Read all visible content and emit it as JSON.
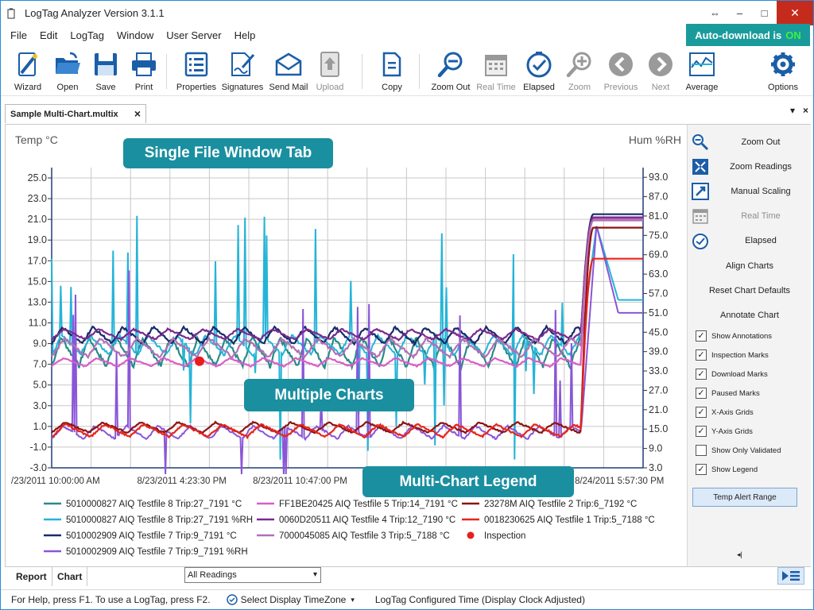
{
  "window": {
    "title": "LogTag Analyzer  Version 3.1.1"
  },
  "menu": [
    "File",
    "Edit",
    "LogTag",
    "Window",
    "User Server",
    "Help"
  ],
  "auto_download": {
    "label": "Auto-download is",
    "state": "ON"
  },
  "toolbar": [
    {
      "label": "Wizard",
      "icon": "wizard-icon",
      "enabled": true
    },
    {
      "label": "Open",
      "icon": "open-folder-icon",
      "enabled": true
    },
    {
      "label": "Save",
      "icon": "save-icon",
      "enabled": true
    },
    {
      "label": "Print",
      "icon": "printer-icon",
      "enabled": true
    },
    {
      "label": "Properties",
      "icon": "properties-icon",
      "enabled": true
    },
    {
      "label": "Signatures",
      "icon": "signatures-icon",
      "enabled": true
    },
    {
      "label": "Send Mail",
      "icon": "mail-icon",
      "enabled": true
    },
    {
      "label": "Upload",
      "icon": "upload-icon",
      "enabled": false
    },
    {
      "label": "Copy",
      "icon": "copy-icon",
      "enabled": true
    },
    {
      "label": "Zoom Out",
      "icon": "zoom-out-icon",
      "enabled": true
    },
    {
      "label": "Real Time",
      "icon": "calendar-icon",
      "enabled": false
    },
    {
      "label": "Elapsed",
      "icon": "clock-check-icon",
      "enabled": true
    },
    {
      "label": "Zoom",
      "icon": "zoom-in-icon",
      "enabled": false
    },
    {
      "label": "Previous",
      "icon": "previous-icon",
      "enabled": false
    },
    {
      "label": "Next",
      "icon": "next-icon",
      "enabled": false
    },
    {
      "label": "Average",
      "icon": "average-chart-icon",
      "enabled": true
    },
    {
      "label": "Options",
      "icon": "gear-icon",
      "enabled": true
    }
  ],
  "document_tab": {
    "label": "Sample Multi-Chart.multix",
    "close": "×"
  },
  "tab_controls": {
    "dropdown": "▾",
    "close": "×"
  },
  "callouts": {
    "tab": "Single File Window Tab",
    "charts": "Multiple Charts",
    "legend": "Multi-Chart Legend"
  },
  "right_panel": {
    "buttons": [
      {
        "label": "Zoom Out",
        "icon": "zoom-out-icon",
        "enabled": true
      },
      {
        "label": "Zoom Readings",
        "icon": "zoom-readings-icon",
        "enabled": true
      },
      {
        "label": "Manual Scaling",
        "icon": "manual-scaling-icon",
        "enabled": true
      },
      {
        "label": "Real Time",
        "icon": "calendar-icon",
        "enabled": false
      },
      {
        "label": "Elapsed",
        "icon": "clock-check-icon",
        "enabled": true
      }
    ],
    "plain": [
      "Align Charts",
      "Reset Chart Defaults",
      "Annotate Chart"
    ],
    "checks": [
      {
        "label": "Show Annotations",
        "checked": true
      },
      {
        "label": "Inspection Marks",
        "checked": true
      },
      {
        "label": "Download Marks",
        "checked": true
      },
      {
        "label": "Paused Marks",
        "checked": true
      },
      {
        "label": "X-Axis Grids",
        "checked": true
      },
      {
        "label": "Y-Axis Grids",
        "checked": true
      },
      {
        "label": "Show Only Validated",
        "checked": false
      },
      {
        "label": "Show Legend",
        "checked": true
      }
    ],
    "alert_button": "Temp Alert Range"
  },
  "bottom": {
    "tabs": [
      "Report",
      "Chart"
    ],
    "select": "All Readings",
    "select_arrow": "▾"
  },
  "status": {
    "help": "For Help, press F1. To use a LogTag, press F2.",
    "timezone": "Select Display TimeZone",
    "configured": "LogTag Configured Time (Display Clock Adjusted)"
  },
  "chart_data": {
    "type": "line",
    "ylabel_left": "Temp °C",
    "ylabel_right": "Hum %RH",
    "y_left_ticks": [
      "25.0",
      "23.0",
      "21.0",
      "19.0",
      "17.0",
      "15.0",
      "13.0",
      "11.0",
      "9.0",
      "7.0",
      "5.0",
      "3.0",
      "1.0",
      "-1.0",
      "-3.0"
    ],
    "y_right_ticks": [
      "93.0",
      "87.0",
      "81.0",
      "75.0",
      "69.0",
      "63.0",
      "57.0",
      "51.0",
      "45.0",
      "39.0",
      "33.0",
      "27.0",
      "21.0",
      "15.0",
      "9.0",
      "3.0"
    ],
    "ylim_left": [
      -3.0,
      26.0
    ],
    "ylim_right": [
      3.0,
      96.0
    ],
    "x_ticks": [
      "/23/2011 10:00:00 AM",
      "8/23/2011 4:23:30 PM",
      "8/23/2011 10:47:00 PM",
      "8/24/2011 5:57:30 PM"
    ],
    "grid": true,
    "inspection_mark": {
      "x_fraction": 0.25,
      "temp": 7.3
    },
    "series": [
      {
        "name": "5010000827 AIQ Testfile 8 Trip:27_7191 °C",
        "color": "#2a8a8a",
        "axis": "left",
        "base": 8.2,
        "amp": 1.4,
        "spike": 0,
        "end": 21.1,
        "end_mode": "rise"
      },
      {
        "name": "5010000827 AIQ Testfile 8 Trip:27_7191 %RH",
        "color": "#25b4d8",
        "axis": "right",
        "base": 41,
        "amp": 3,
        "spike": 7,
        "end": 55,
        "end_mode": "riseFall"
      },
      {
        "name": "5010002909 AIQ Testfile 7 Trip:9_7191 °C",
        "color": "#1b2a6b",
        "axis": "left",
        "base": 9.8,
        "amp": 0.8,
        "spike": 0,
        "end": 21.5,
        "end_mode": "rise"
      },
      {
        "name": "5010002909 AIQ Testfile 7 Trip:9_7191 %RH",
        "color": "#8a55d8",
        "axis": "right",
        "base": 14,
        "amp": 2,
        "spike": 9,
        "end": 51,
        "end_mode": "riseFall"
      },
      {
        "name": "FF1BE20425 AIQ Testfile 5 Trip:14_7191 °C",
        "color": "#d95ec8",
        "axis": "left",
        "base": 7.2,
        "amp": 0.4,
        "spike": 0,
        "end": 21.0,
        "end_mode": "rise"
      },
      {
        "name": "0060D20511 AIQ Testfile 4 Trip:12_7190 °C",
        "color": "#7b2a8e",
        "axis": "left",
        "base": 9.9,
        "amp": 0.5,
        "spike": 0,
        "end": 21.2,
        "end_mode": "rise"
      },
      {
        "name": "7000045085 AIQ Testfile 3 Trip:5_7188 °C",
        "color": "#b071b4",
        "axis": "left",
        "base": 8.6,
        "amp": 0.9,
        "spike": 0,
        "end": 20.9,
        "end_mode": "rise"
      },
      {
        "name": "23278M AIQ Testfile 2 Trip:6_7192 °C",
        "color": "#8b1414",
        "axis": "left",
        "base": 0.9,
        "amp": 0.5,
        "spike": 0,
        "end": 20.2,
        "end_mode": "rise"
      },
      {
        "name": "0018230625 AIQ Testfile 1 Trip:5_7188 °C",
        "color": "#e6261d",
        "axis": "left",
        "base": 0.6,
        "amp": 0.6,
        "spike": 0,
        "end": 17.2,
        "end_mode": "rise"
      }
    ],
    "legend_extra": "Inspection"
  }
}
